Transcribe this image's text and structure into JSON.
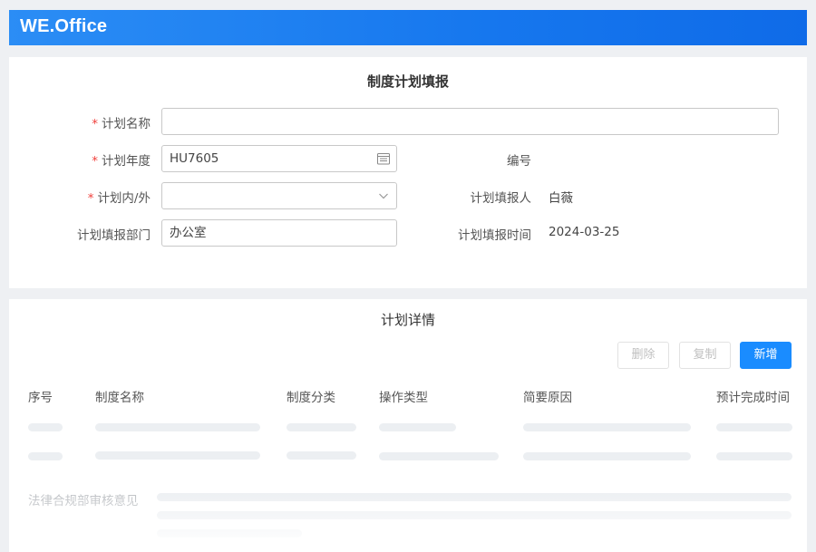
{
  "header": {
    "logo": "WE.Office"
  },
  "form": {
    "title": "制度计划填报",
    "required_mark": "*",
    "plan_name_label": "计划名称",
    "plan_name_value": "",
    "plan_year_label": "计划年度",
    "plan_year_value": "HU7605",
    "plan_scope_label": "计划内/外",
    "plan_scope_value": "",
    "dept_label": "计划填报部门",
    "dept_value": "办公室",
    "number_label": "编号",
    "number_value": "",
    "reporter_label": "计划填报人",
    "reporter_value": "白薇",
    "report_time_label": "计划填报时间",
    "report_time_value": "2024-03-25"
  },
  "details": {
    "title": "计划详情",
    "delete_label": "删除",
    "copy_label": "复制",
    "add_label": "新增",
    "columns": [
      "序号",
      "制度名称",
      "制度分类",
      "操作类型",
      "简要原因",
      "预计完成时间"
    ],
    "legal_label": "法律合规部审核意见"
  },
  "colors": {
    "header": "#1677ee",
    "primary": "#1a8cff",
    "required": "#f0413d"
  },
  "icons": {
    "calendar": "calendar-icon",
    "dropdown": "chevron-down-icon"
  }
}
